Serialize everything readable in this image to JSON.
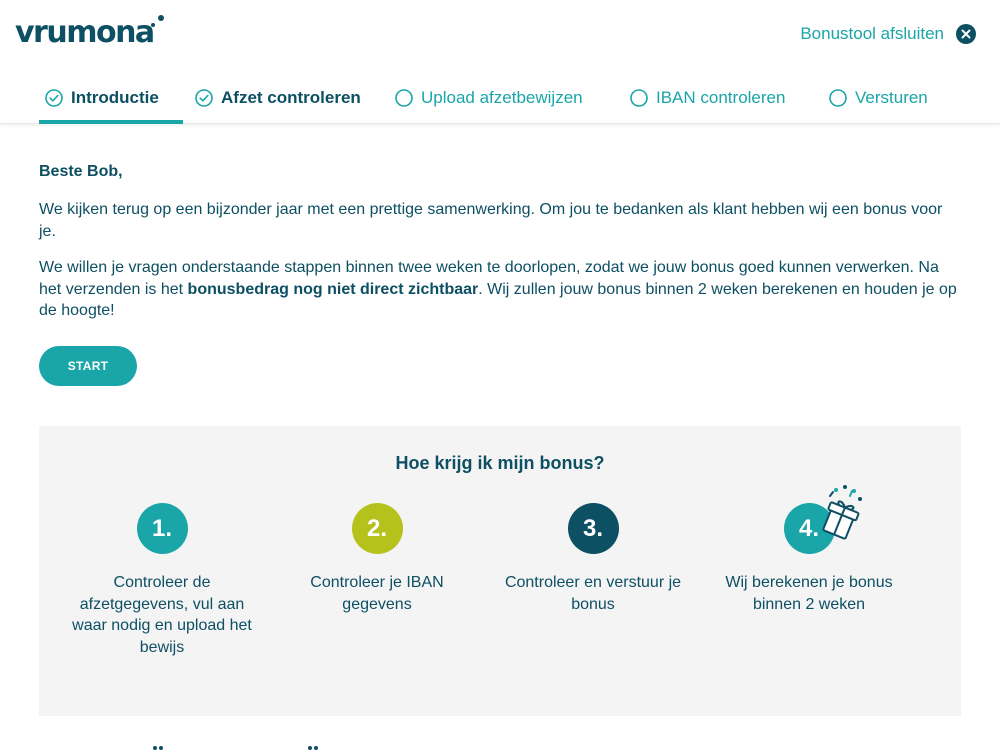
{
  "brand": {
    "logo_text": "vrumona"
  },
  "header": {
    "exit_label": "Bonustool afsluiten"
  },
  "tabs": [
    {
      "label": "Introductie",
      "state": "done",
      "active": true
    },
    {
      "label": "Afzet controleren",
      "state": "done",
      "active": false
    },
    {
      "label": "Upload afzetbewijzen",
      "state": "todo",
      "active": false
    },
    {
      "label": "IBAN controleren",
      "state": "todo",
      "active": false
    },
    {
      "label": "Versturen",
      "state": "todo",
      "active": false
    }
  ],
  "intro": {
    "greeting": "Beste Bob,",
    "paragraph1": "We kijken terug op een bijzonder jaar met een prettige samenwerking. Om jou te bedanken als klant hebben wij een bonus voor je.",
    "paragraph2_before": "We willen je vragen onderstaande stappen binnen twee weken te doorlopen, zodat we jouw bonus goed kunnen verwerken. Na het verzenden is het ",
    "paragraph2_bold": "bonusbedrag nog niet direct zichtbaar",
    "paragraph2_after": ". Wij zullen jouw bonus binnen 2 weken berekenen en houden je op de hoogte!",
    "start_label": "START"
  },
  "steps_section": {
    "title": "Hoe krijg ik mijn bonus?",
    "steps": [
      {
        "number": "1.",
        "text": "Controleer de afzetgegevens, vul aan waar nodig en upload het bewijs",
        "color": "#1aa5a8"
      },
      {
        "number": "2.",
        "text": "Controleer je IBAN gegevens",
        "color": "#b5c21b"
      },
      {
        "number": "3.",
        "text": "Controleer en verstuur je bonus",
        "color": "#0d4f63"
      },
      {
        "number": "4.",
        "text": "Wij berekenen je bonus binnen 2 weken",
        "color": "#1aa5a8",
        "icon": "gift-icon"
      }
    ]
  },
  "colors": {
    "primary": "#0d4f63",
    "accent": "#1aa5a8",
    "lime": "#b5c21b",
    "panel_bg": "#f4f4f4"
  }
}
